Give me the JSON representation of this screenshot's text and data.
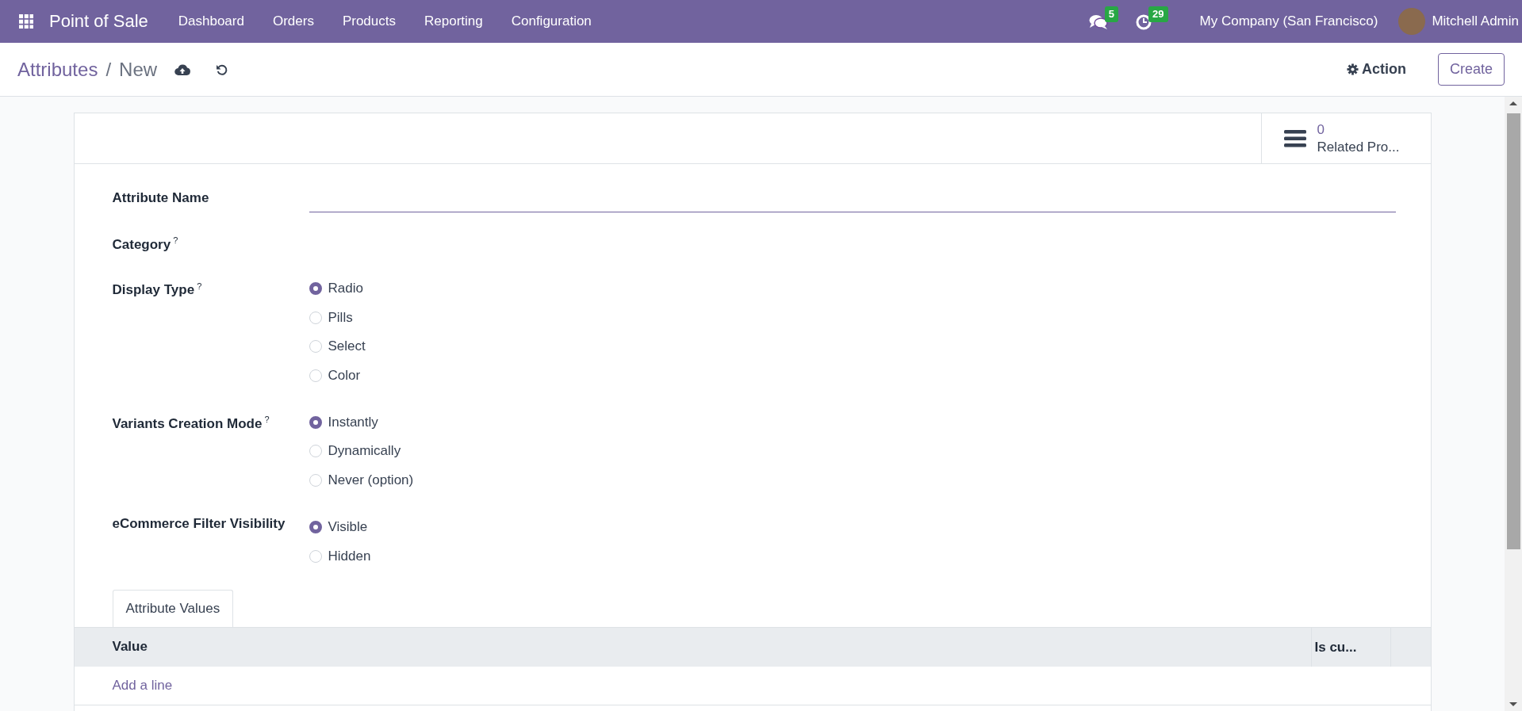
{
  "navbar": {
    "app_name": "Point of Sale",
    "menu": [
      "Dashboard",
      "Orders",
      "Products",
      "Reporting",
      "Configuration"
    ],
    "messages_count": "5",
    "activities_count": "29",
    "company": "My Company (San Francisco)",
    "user": "Mitchell Admin"
  },
  "control_panel": {
    "breadcrumb": [
      "Attributes",
      "New"
    ],
    "separator": "/",
    "action": "Action",
    "create": "Create"
  },
  "button_box": {
    "count": "0",
    "label": "Related Pro..."
  },
  "fields": [
    {
      "kind": "text",
      "label": "Attribute Name"
    },
    {
      "kind": "empty",
      "label": "Category",
      "help": "?"
    },
    {
      "kind": "radio",
      "label": "Display Type",
      "help": "?",
      "options": [
        {
          "label": "Radio",
          "selected": true
        },
        {
          "label": "Pills",
          "selected": false
        },
        {
          "label": "Select",
          "selected": false
        },
        {
          "label": "Color",
          "selected": false
        }
      ]
    },
    {
      "kind": "radio",
      "label": "Variants Creation Mode",
      "help": "?",
      "options": [
        {
          "label": "Instantly",
          "selected": true
        },
        {
          "label": "Dynamically",
          "selected": false
        },
        {
          "label": "Never (option)",
          "selected": false
        }
      ]
    },
    {
      "kind": "radio",
      "label": "eCommerce Filter Visibility",
      "options": [
        {
          "label": "Visible",
          "selected": true
        },
        {
          "label": "Hidden",
          "selected": false
        }
      ]
    }
  ],
  "tabs": [
    {
      "label": "Attribute Values",
      "selected": true
    }
  ],
  "table": {
    "columns": [
      "Value",
      "Is cu..."
    ],
    "add_line": "Add a line"
  }
}
